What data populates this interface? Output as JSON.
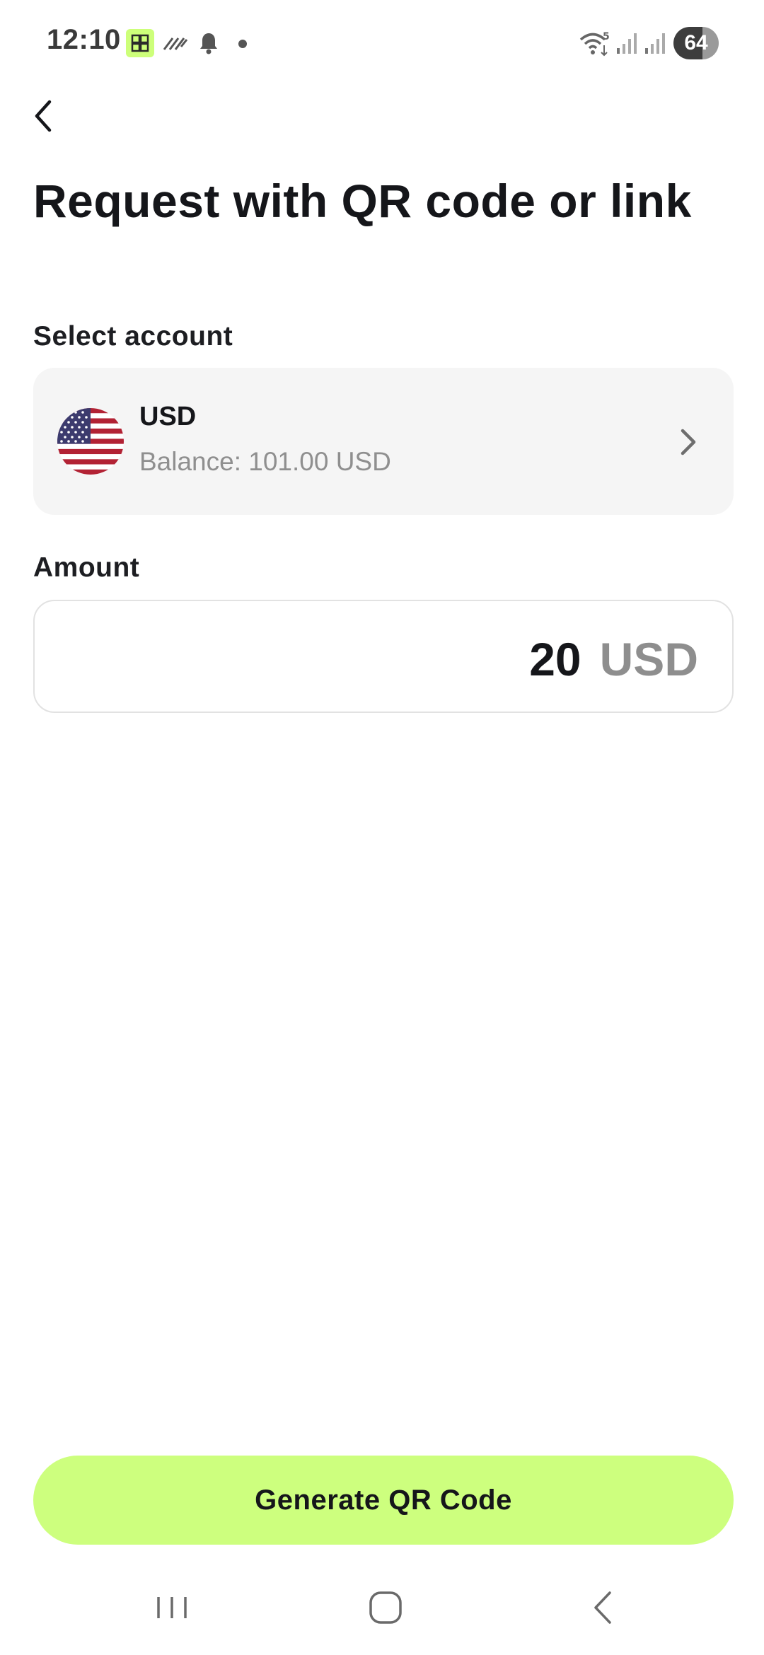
{
  "status_bar": {
    "time": "12:10",
    "battery": "64",
    "icons": [
      "app-notification-icon",
      "signal-pattern-icon",
      "bell-icon",
      "dot-icon",
      "wifi-icon",
      "cell-signal-icon",
      "cell-signal-icon"
    ]
  },
  "header": {
    "back_icon": "chevron-left-icon",
    "title": "Request with QR code or link"
  },
  "account_section": {
    "label": "Select account",
    "selected": {
      "flag": "us-flag-icon",
      "currency": "USD",
      "balance": "Balance: 101.00 USD"
    }
  },
  "amount_section": {
    "label": "Amount",
    "value": "20",
    "currency": "USD"
  },
  "actions": {
    "generate_label": "Generate QR Code"
  },
  "nav_bar": {
    "buttons": [
      "recents-icon",
      "home-icon",
      "back-icon"
    ]
  },
  "colors": {
    "accent": "#cdff7e",
    "text_primary": "#15161a",
    "text_secondary": "#8f8f8f",
    "card_bg": "#f5f5f5"
  }
}
